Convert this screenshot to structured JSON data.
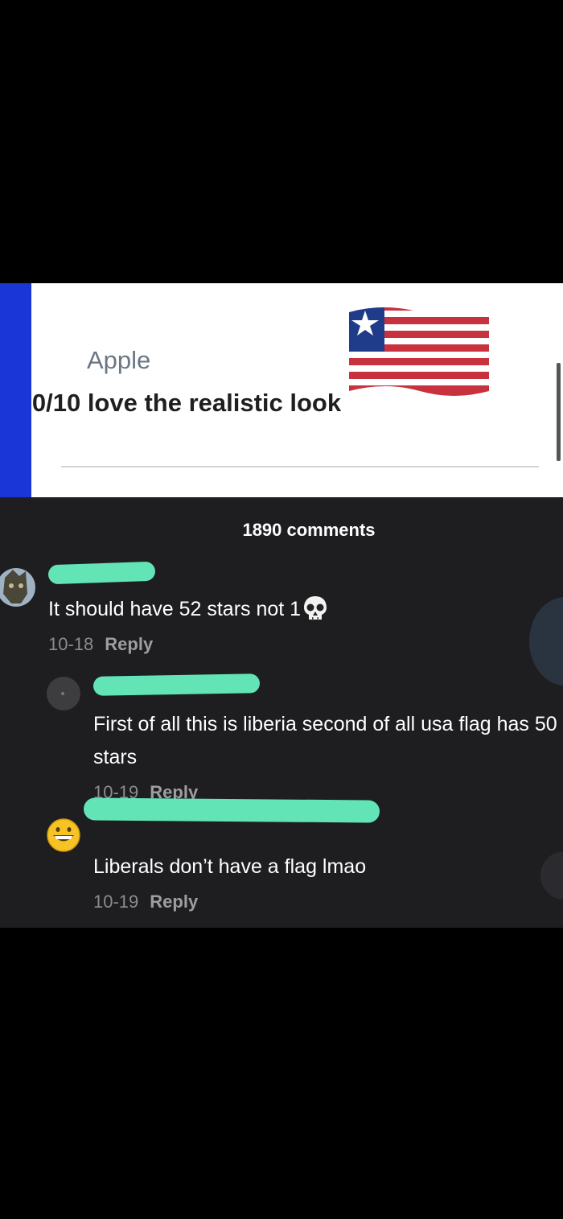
{
  "post": {
    "author": "Apple",
    "caption": "0/10 love the realistic look",
    "flag_icon": "liberia-flag-emoji"
  },
  "comments_count": "1890 comments",
  "comments": [
    {
      "text": "It should have 52 stars not 1",
      "emoji": "skull-emoji",
      "date": "10-18",
      "reply_label": "Reply"
    },
    {
      "text": "First of all this is liberia second of all usa flag has 50 stars",
      "date": "10-19",
      "reply_label": "Reply"
    },
    {
      "text": "Liberals don’t have a flag lmao",
      "date": "10-19",
      "reply_label": "Reply"
    }
  ],
  "colors": {
    "redaction": "#63e4b7",
    "comment_bg": "#1e1e21",
    "post_blue": "#1a36d6"
  }
}
